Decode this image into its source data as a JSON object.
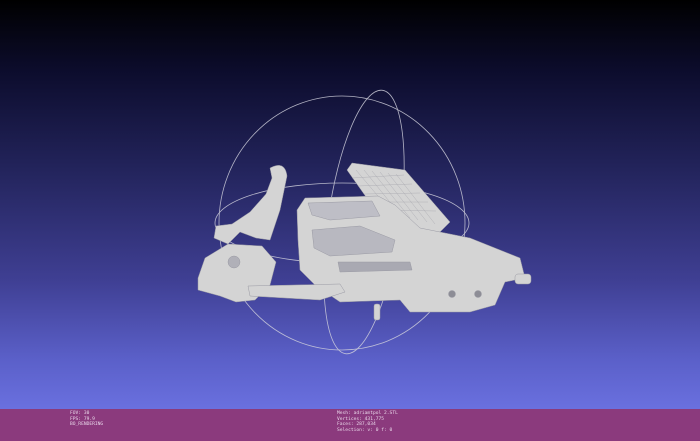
{
  "viewer": {
    "background_top": "#000000",
    "background_bottom": "#6a70df",
    "mesh_color": "#d4d4d4",
    "trackball_color": "#d0d0dc"
  },
  "status_bar": {
    "color": "#8b3a7d",
    "left_lines": [
      "FOV: 30",
      "FPS:  79.9",
      "BO_RENDERING"
    ],
    "right_lines": [
      "Mesh: adriamtpol 2.STL",
      "Vertices: 431,775",
      "Faces: 287,034",
      "Selection: v: 0 f: 0"
    ]
  }
}
